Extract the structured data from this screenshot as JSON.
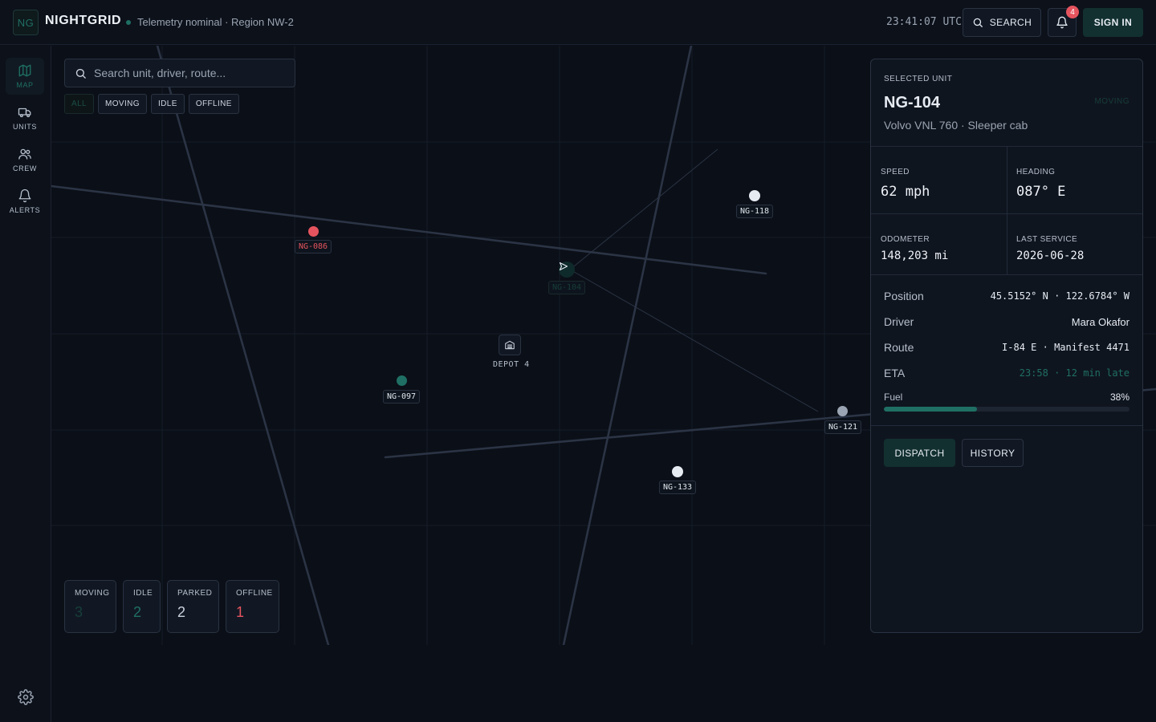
{
  "app": {
    "logo_initials": "NG",
    "name": "NIGHTGRID",
    "status": "Telemetry nominal · Region NW-2",
    "clock": "23:41:07 UTC",
    "search_label": "SEARCH",
    "notification_count": "4",
    "signin_label": "SIGN IN"
  },
  "sidebar": {
    "items": [
      {
        "label": "MAP",
        "icon": "map-icon",
        "active": true
      },
      {
        "label": "UNITS",
        "icon": "truck-icon",
        "active": false
      },
      {
        "label": "CREW",
        "icon": "users-icon",
        "active": false
      },
      {
        "label": "ALERTS",
        "icon": "bell-icon",
        "active": false
      }
    ],
    "settings_icon": "gear-icon"
  },
  "map": {
    "search_placeholder": "Search unit, driver, route...",
    "filters": [
      "ALL",
      "MOVING",
      "IDLE",
      "OFFLINE"
    ],
    "active_filter": "ALL",
    "units": [
      {
        "id": "NG-086",
        "status": "offline",
        "color": "#e5545e"
      },
      {
        "id": "NG-118",
        "status": "parked",
        "color": "#e6ebf2"
      },
      {
        "id": "NG-104",
        "status": "moving",
        "color": "#1f6f64",
        "selected": true
      },
      {
        "id": "NG-097",
        "status": "idle",
        "color": "#1f6f64"
      },
      {
        "id": "NG-121",
        "status": "parked",
        "color": "#9aa4b2"
      },
      {
        "id": "NG-133",
        "status": "parked",
        "color": "#e6ebf2"
      }
    ],
    "depot_label": "DEPOT 4",
    "stats": [
      {
        "label": "MOVING",
        "value": "3",
        "color": "#173e39"
      },
      {
        "label": "IDLE",
        "value": "2",
        "color": "#1f6f64"
      },
      {
        "label": "PARKED",
        "value": "2",
        "color": "#c9d1dc"
      },
      {
        "label": "OFFLINE",
        "value": "1",
        "color": "#e5545e"
      }
    ]
  },
  "panel": {
    "eyebrow": "SELECTED UNIT",
    "unit_id": "NG-104",
    "status_pill": "MOVING",
    "vehicle": "Volvo VNL 760 · Sleeper cab",
    "speed_label": "SPEED",
    "speed": "62 mph",
    "heading_label": "HEADING",
    "heading": "087° E",
    "odometer_label": "ODOMETER",
    "odometer": "148,203 mi",
    "service_label": "LAST SERVICE",
    "service": "2026-06-28",
    "position_label": "Position",
    "position": "45.5152° N · 122.6784° W",
    "driver_label": "Driver",
    "driver": "Mara Okafor",
    "route_label": "Route",
    "route": "I-84 E · Manifest 4471",
    "eta_label": "ETA",
    "eta": "23:58 · 12 min late",
    "fuel_label": "Fuel",
    "fuel_pct": "38%",
    "fuel_fraction": 0.38,
    "dispatch_label": "DISPATCH",
    "history_label": "HISTORY"
  }
}
